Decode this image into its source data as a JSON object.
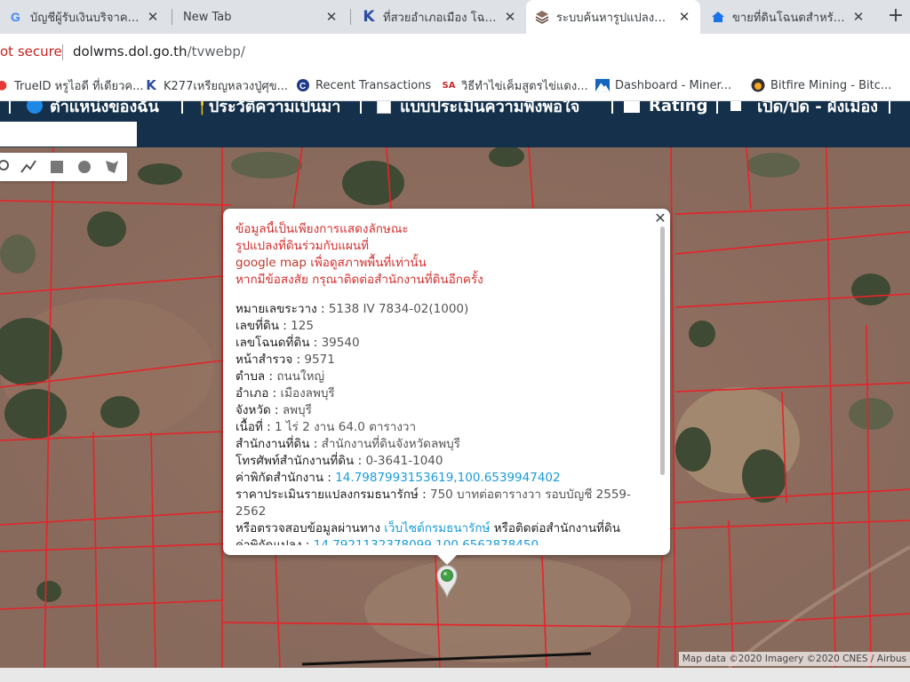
{
  "tabs": [
    {
      "label": "บัญชีผู้รับเงินบริจาค คณ",
      "icon": "google-icon"
    },
    {
      "label": "New Tab",
      "icon": ""
    },
    {
      "label": "ที่สวยอำเภอเมือง โฉนด",
      "icon": "k-icon"
    },
    {
      "label": "ระบบค้นหารูปแปลงที่ดิน",
      "icon": "stack-icon"
    },
    {
      "label": "ขายที่ดินโฉนดสำหรับปลู",
      "icon": "home-icon"
    }
  ],
  "address": {
    "insecure": "ot secure",
    "host": "dolwms.dol.go.th",
    "path": "/tvwebp/"
  },
  "bookmarks": [
    {
      "label": "TrueID หรูไอดี ที่เดียวค...",
      "icon": "trueid-icon"
    },
    {
      "label": "K277เหรียญหลวงปู่ศุข...",
      "icon": "k-icon"
    },
    {
      "label": "Recent Transactions",
      "icon": "c-icon"
    },
    {
      "label": "วิธีทำไข่เค็มสูตรไข่แดง...",
      "icon": "sa-icon"
    },
    {
      "label": "Dashboard - Miner...",
      "icon": "mountain-icon"
    },
    {
      "label": "Bitfire Mining - Bitc...",
      "icon": "bitfire-icon"
    }
  ],
  "nav": {
    "item_location": "ตำแหน่งของฉัน",
    "item_history": "ประวัติความเป็นมา",
    "item_survey": "แบบประเมินความพึงพอใจ",
    "item_rating": "Rating",
    "item_toggle": "เปิด/ปิด - ผังเมือง",
    "search_placeholder": ""
  },
  "popup": {
    "warn_line1": "ข้อมูลนี้เป็นเพียงการแสดงลักษณะ",
    "warn_line2": "รูปแปลงที่ดินร่วมกับแผนที่",
    "warn_line3_a": "google map",
    "warn_line3_b": " เพื่อดูสภาพพื้นที่เท่านั้น",
    "warn_line4": "หากมีข้อสงสัย กรุณาติดต่อสำนักงานที่ดินอีกครั้ง",
    "rows": [
      {
        "label": "หมายเลขระวาง",
        "value": "5138 IV 7834-02(1000)"
      },
      {
        "label": "เลขที่ดิน",
        "value": "125"
      },
      {
        "label": "เลขโฉนดที่ดิน",
        "value": "39540"
      },
      {
        "label": "หน้าสำรวจ",
        "value": "9571"
      },
      {
        "label": "ตำบล",
        "value": "ถนนใหญ่"
      },
      {
        "label": "อำเภอ",
        "value": "เมืองลพบุรี"
      },
      {
        "label": "จังหวัด",
        "value": "ลพบุรี"
      },
      {
        "label": "เนื้อที่",
        "value": "1 ไร่ 2 งาน 64.0 ตารางวา"
      },
      {
        "label": "สำนักงานที่ดิน",
        "value": "สำนักงานที่ดินจังหวัดลพบุรี"
      },
      {
        "label": "โทรศัพท์สำนักงานที่ดิน",
        "value": "0-3641-1040"
      }
    ],
    "office_coord_label": "ค่าพิกัดสำนักงาน",
    "office_coord": "14.7987993153619,100.6539947402",
    "price_label": "ราคาประเมินรายแปลงกรมธนารักษ์",
    "price_value": "750 บาทต่อตารางวา รอบบัญชี 2559-2562",
    "check_prefix": "หรือตรวจสอบข้อมูลผ่านทาง ",
    "check_link": "เว็บไซต์กรมธนารักษ์",
    "check_suffix": " หรือติดต่อสำนักงานที่ดิน",
    "parcel_coord_label": "ค่าพิกัดแปลง",
    "parcel_coord": "14.7921132378099,100.6562878450"
  },
  "attribution": "Map data ©2020 Imagery ©2020 CNES / Airbus",
  "colors": {
    "nav_bg": "#14304a",
    "parcel_line": "#e8222a",
    "warn": "#d32f2f",
    "link": "#1a9bd7"
  }
}
